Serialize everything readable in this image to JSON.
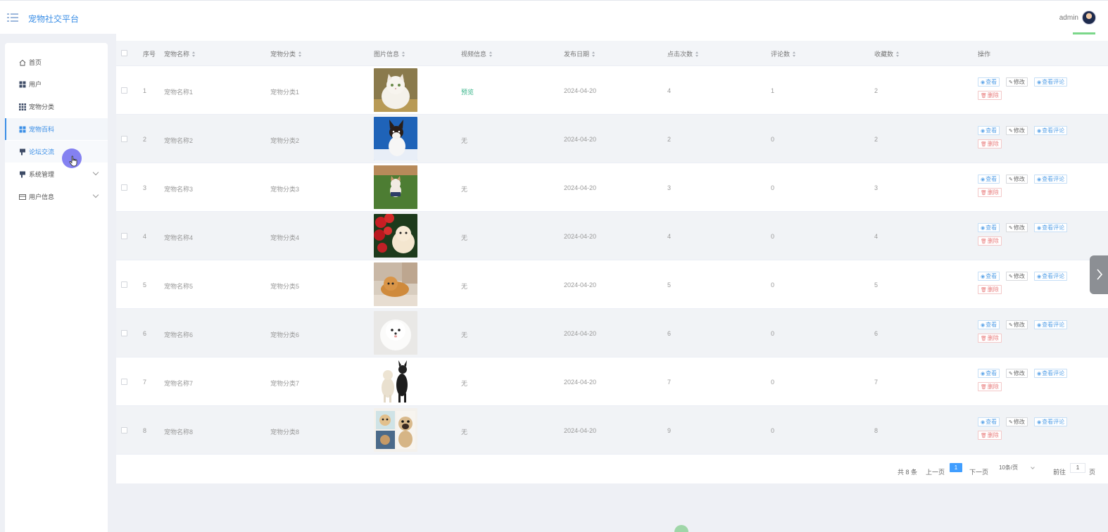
{
  "app": {
    "title": "宠物社交平台",
    "username": "admin",
    "accent_color": "#3a8ee6"
  },
  "sidebar": {
    "items": [
      {
        "label": "首页",
        "icon": "home-icon"
      },
      {
        "label": "用户",
        "icon": "grid-icon"
      },
      {
        "label": "宠物分类",
        "icon": "apps-icon"
      },
      {
        "label": "宠物百科",
        "icon": "grid-icon",
        "active": true
      },
      {
        "label": "论坛交流",
        "icon": "flag-icon",
        "hover": true
      },
      {
        "label": "系统管理",
        "icon": "flag-icon",
        "expandable": true
      },
      {
        "label": "用户信息",
        "icon": "card-icon",
        "expandable": true
      }
    ]
  },
  "table": {
    "columns": [
      "序号",
      "宠物名称",
      "宠物分类",
      "图片信息",
      "视频信息",
      "发布日期",
      "点击次数",
      "评论数",
      "收藏数",
      "操作"
    ],
    "actions": {
      "view": "查看",
      "edit": "修改",
      "comments": "查看评论",
      "delete": "删除"
    },
    "rows": [
      {
        "index": "1",
        "name": "宠物名称1",
        "category": "宠物分类1",
        "image": "white-fluffy-cat",
        "video": "预览",
        "date": "2024-04-20",
        "clicks": "4",
        "comments": "1",
        "favorites": "2"
      },
      {
        "index": "2",
        "name": "宠物名称2",
        "category": "宠物分类2",
        "image": "corgi-on-blue",
        "video": "无",
        "date": "2024-04-20",
        "clicks": "2",
        "comments": "0",
        "favorites": "2"
      },
      {
        "index": "3",
        "name": "宠物名称3",
        "category": "宠物分类3",
        "image": "small-dog-on-grass",
        "video": "无",
        "date": "2024-04-20",
        "clicks": "3",
        "comments": "0",
        "favorites": "3"
      },
      {
        "index": "4",
        "name": "宠物名称4",
        "category": "宠物分类4",
        "image": "pomeranian-with-roses",
        "video": "无",
        "date": "2024-04-20",
        "clicks": "4",
        "comments": "0",
        "favorites": "4"
      },
      {
        "index": "5",
        "name": "宠物名称5",
        "category": "宠物分类5",
        "image": "pomeranian-lying",
        "video": "无",
        "date": "2024-04-20",
        "clicks": "5",
        "comments": "0",
        "favorites": "5"
      },
      {
        "index": "6",
        "name": "宠物名称6",
        "category": "宠物分类6",
        "image": "white-fluffy-dog",
        "video": "无",
        "date": "2024-04-20",
        "clicks": "6",
        "comments": "0",
        "favorites": "6"
      },
      {
        "index": "7",
        "name": "宠物名称7",
        "category": "宠物分类7",
        "image": "two-dogs-standing",
        "video": "无",
        "date": "2024-04-20",
        "clicks": "7",
        "comments": "0",
        "favorites": "7"
      },
      {
        "index": "8",
        "name": "宠物名称8",
        "category": "宠物分类8",
        "image": "pug-collage",
        "video": "无",
        "date": "2024-04-20",
        "clicks": "9",
        "comments": "0",
        "favorites": "8"
      }
    ]
  },
  "pagination": {
    "total": "共 8 条",
    "prev": "上一页",
    "current": "1",
    "next": "下一页",
    "page_size": "10条/页",
    "goto_label": "前往",
    "goto_value": "1",
    "page_suffix": "页"
  }
}
